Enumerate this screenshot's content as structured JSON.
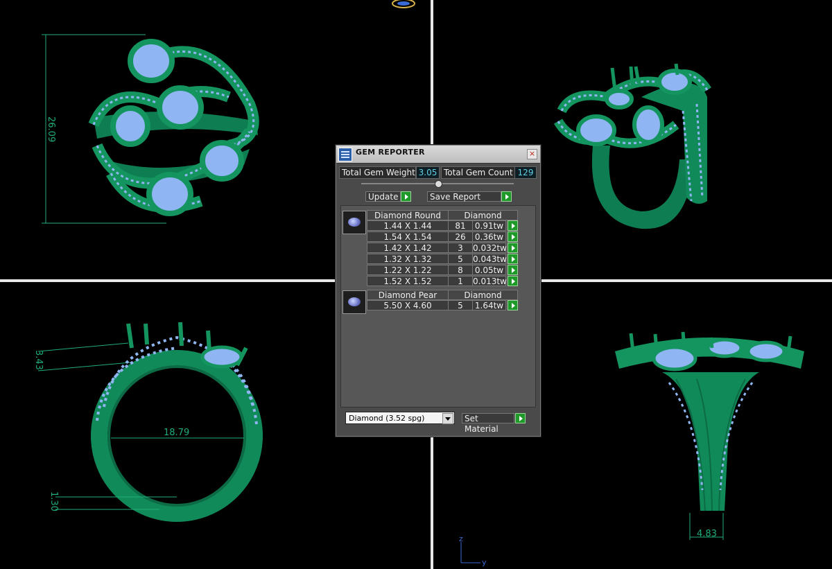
{
  "viewports": {
    "top_view": {
      "dimension": "26.09"
    },
    "front_view": {
      "dimension_inner": "18.79",
      "dimension_top": "3.43",
      "dimension_bottom": "1.30"
    },
    "side_view": {
      "dimension": "4.83"
    },
    "axis": {
      "z": "z",
      "y": "y"
    }
  },
  "colors": {
    "metal": "#118a5a",
    "stone": "#8fb6f2",
    "dimension_line": "#1fae7a",
    "accent_button": "#1f9a2a"
  },
  "gem_reporter": {
    "title": "GEM REPORTER",
    "close_icon": "×",
    "total_weight_label": "Total Gem Weight",
    "total_weight_value": "3.05",
    "total_count_label": "Total Gem Count",
    "total_count_value": "129",
    "update_label": "Update",
    "save_report_label": "Save Report",
    "groups": [
      {
        "name": "Diamond Round",
        "material": "Diamond",
        "rows": [
          {
            "size": "1.44 X 1.44",
            "count": "81",
            "weight": "0.91tw"
          },
          {
            "size": "1.54 X 1.54",
            "count": "26",
            "weight": "0.36tw"
          },
          {
            "size": "1.42 X 1.42",
            "count": "3",
            "weight": "0.032tw"
          },
          {
            "size": "1.32 X 1.32",
            "count": "5",
            "weight": "0.043tw"
          },
          {
            "size": "1.22 X 1.22",
            "count": "8",
            "weight": "0.05tw"
          },
          {
            "size": "1.52 X 1.52",
            "count": "1",
            "weight": "0.013tw"
          }
        ]
      },
      {
        "name": "Diamond Pear",
        "material": "Diamond",
        "rows": [
          {
            "size": "5.50 X 4.60",
            "count": "5",
            "weight": "1.64tw"
          }
        ]
      }
    ],
    "material_select": "Diamond      (3.52 spg)",
    "set_material_label": "Set Material"
  }
}
